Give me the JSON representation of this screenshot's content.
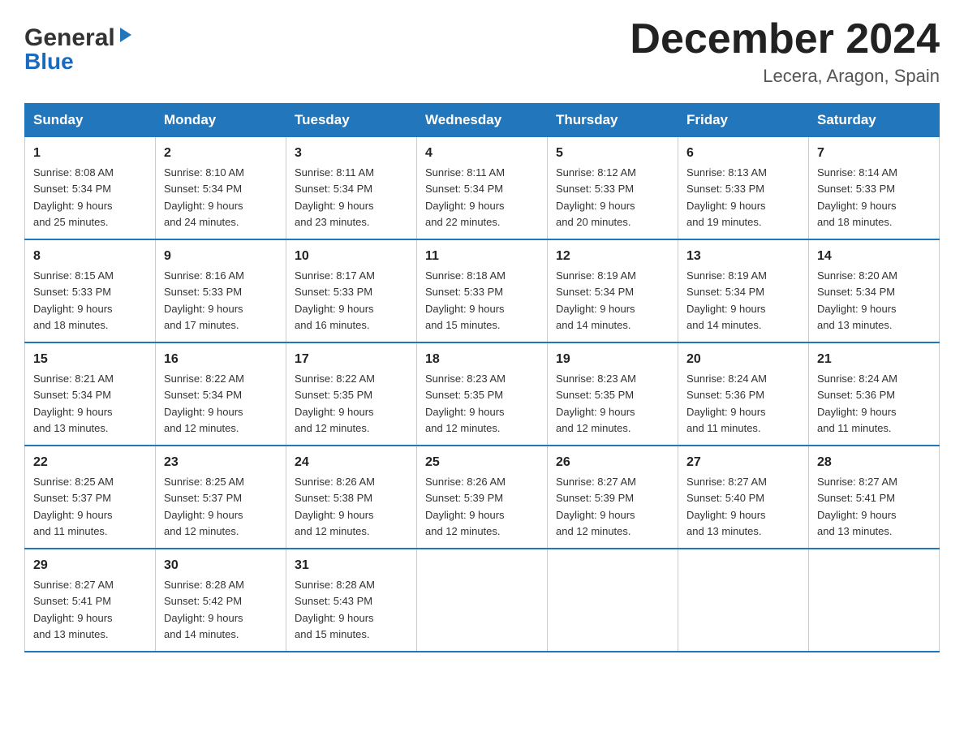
{
  "logo": {
    "general": "General",
    "blue": "Blue"
  },
  "header": {
    "month": "December 2024",
    "location": "Lecera, Aragon, Spain"
  },
  "days_header": [
    "Sunday",
    "Monday",
    "Tuesday",
    "Wednesday",
    "Thursday",
    "Friday",
    "Saturday"
  ],
  "weeks": [
    [
      {
        "day": "1",
        "sunrise": "8:08 AM",
        "sunset": "5:34 PM",
        "daylight": "9 hours and 25 minutes."
      },
      {
        "day": "2",
        "sunrise": "8:10 AM",
        "sunset": "5:34 PM",
        "daylight": "9 hours and 24 minutes."
      },
      {
        "day": "3",
        "sunrise": "8:11 AM",
        "sunset": "5:34 PM",
        "daylight": "9 hours and 23 minutes."
      },
      {
        "day": "4",
        "sunrise": "8:11 AM",
        "sunset": "5:34 PM",
        "daylight": "9 hours and 22 minutes."
      },
      {
        "day": "5",
        "sunrise": "8:12 AM",
        "sunset": "5:33 PM",
        "daylight": "9 hours and 20 minutes."
      },
      {
        "day": "6",
        "sunrise": "8:13 AM",
        "sunset": "5:33 PM",
        "daylight": "9 hours and 19 minutes."
      },
      {
        "day": "7",
        "sunrise": "8:14 AM",
        "sunset": "5:33 PM",
        "daylight": "9 hours and 18 minutes."
      }
    ],
    [
      {
        "day": "8",
        "sunrise": "8:15 AM",
        "sunset": "5:33 PM",
        "daylight": "9 hours and 18 minutes."
      },
      {
        "day": "9",
        "sunrise": "8:16 AM",
        "sunset": "5:33 PM",
        "daylight": "9 hours and 17 minutes."
      },
      {
        "day": "10",
        "sunrise": "8:17 AM",
        "sunset": "5:33 PM",
        "daylight": "9 hours and 16 minutes."
      },
      {
        "day": "11",
        "sunrise": "8:18 AM",
        "sunset": "5:33 PM",
        "daylight": "9 hours and 15 minutes."
      },
      {
        "day": "12",
        "sunrise": "8:19 AM",
        "sunset": "5:34 PM",
        "daylight": "9 hours and 14 minutes."
      },
      {
        "day": "13",
        "sunrise": "8:19 AM",
        "sunset": "5:34 PM",
        "daylight": "9 hours and 14 minutes."
      },
      {
        "day": "14",
        "sunrise": "8:20 AM",
        "sunset": "5:34 PM",
        "daylight": "9 hours and 13 minutes."
      }
    ],
    [
      {
        "day": "15",
        "sunrise": "8:21 AM",
        "sunset": "5:34 PM",
        "daylight": "9 hours and 13 minutes."
      },
      {
        "day": "16",
        "sunrise": "8:22 AM",
        "sunset": "5:34 PM",
        "daylight": "9 hours and 12 minutes."
      },
      {
        "day": "17",
        "sunrise": "8:22 AM",
        "sunset": "5:35 PM",
        "daylight": "9 hours and 12 minutes."
      },
      {
        "day": "18",
        "sunrise": "8:23 AM",
        "sunset": "5:35 PM",
        "daylight": "9 hours and 12 minutes."
      },
      {
        "day": "19",
        "sunrise": "8:23 AM",
        "sunset": "5:35 PM",
        "daylight": "9 hours and 12 minutes."
      },
      {
        "day": "20",
        "sunrise": "8:24 AM",
        "sunset": "5:36 PM",
        "daylight": "9 hours and 11 minutes."
      },
      {
        "day": "21",
        "sunrise": "8:24 AM",
        "sunset": "5:36 PM",
        "daylight": "9 hours and 11 minutes."
      }
    ],
    [
      {
        "day": "22",
        "sunrise": "8:25 AM",
        "sunset": "5:37 PM",
        "daylight": "9 hours and 11 minutes."
      },
      {
        "day": "23",
        "sunrise": "8:25 AM",
        "sunset": "5:37 PM",
        "daylight": "9 hours and 12 minutes."
      },
      {
        "day": "24",
        "sunrise": "8:26 AM",
        "sunset": "5:38 PM",
        "daylight": "9 hours and 12 minutes."
      },
      {
        "day": "25",
        "sunrise": "8:26 AM",
        "sunset": "5:39 PM",
        "daylight": "9 hours and 12 minutes."
      },
      {
        "day": "26",
        "sunrise": "8:27 AM",
        "sunset": "5:39 PM",
        "daylight": "9 hours and 12 minutes."
      },
      {
        "day": "27",
        "sunrise": "8:27 AM",
        "sunset": "5:40 PM",
        "daylight": "9 hours and 13 minutes."
      },
      {
        "day": "28",
        "sunrise": "8:27 AM",
        "sunset": "5:41 PM",
        "daylight": "9 hours and 13 minutes."
      }
    ],
    [
      {
        "day": "29",
        "sunrise": "8:27 AM",
        "sunset": "5:41 PM",
        "daylight": "9 hours and 13 minutes."
      },
      {
        "day": "30",
        "sunrise": "8:28 AM",
        "sunset": "5:42 PM",
        "daylight": "9 hours and 14 minutes."
      },
      {
        "day": "31",
        "sunrise": "8:28 AM",
        "sunset": "5:43 PM",
        "daylight": "9 hours and 15 minutes."
      },
      null,
      null,
      null,
      null
    ]
  ]
}
